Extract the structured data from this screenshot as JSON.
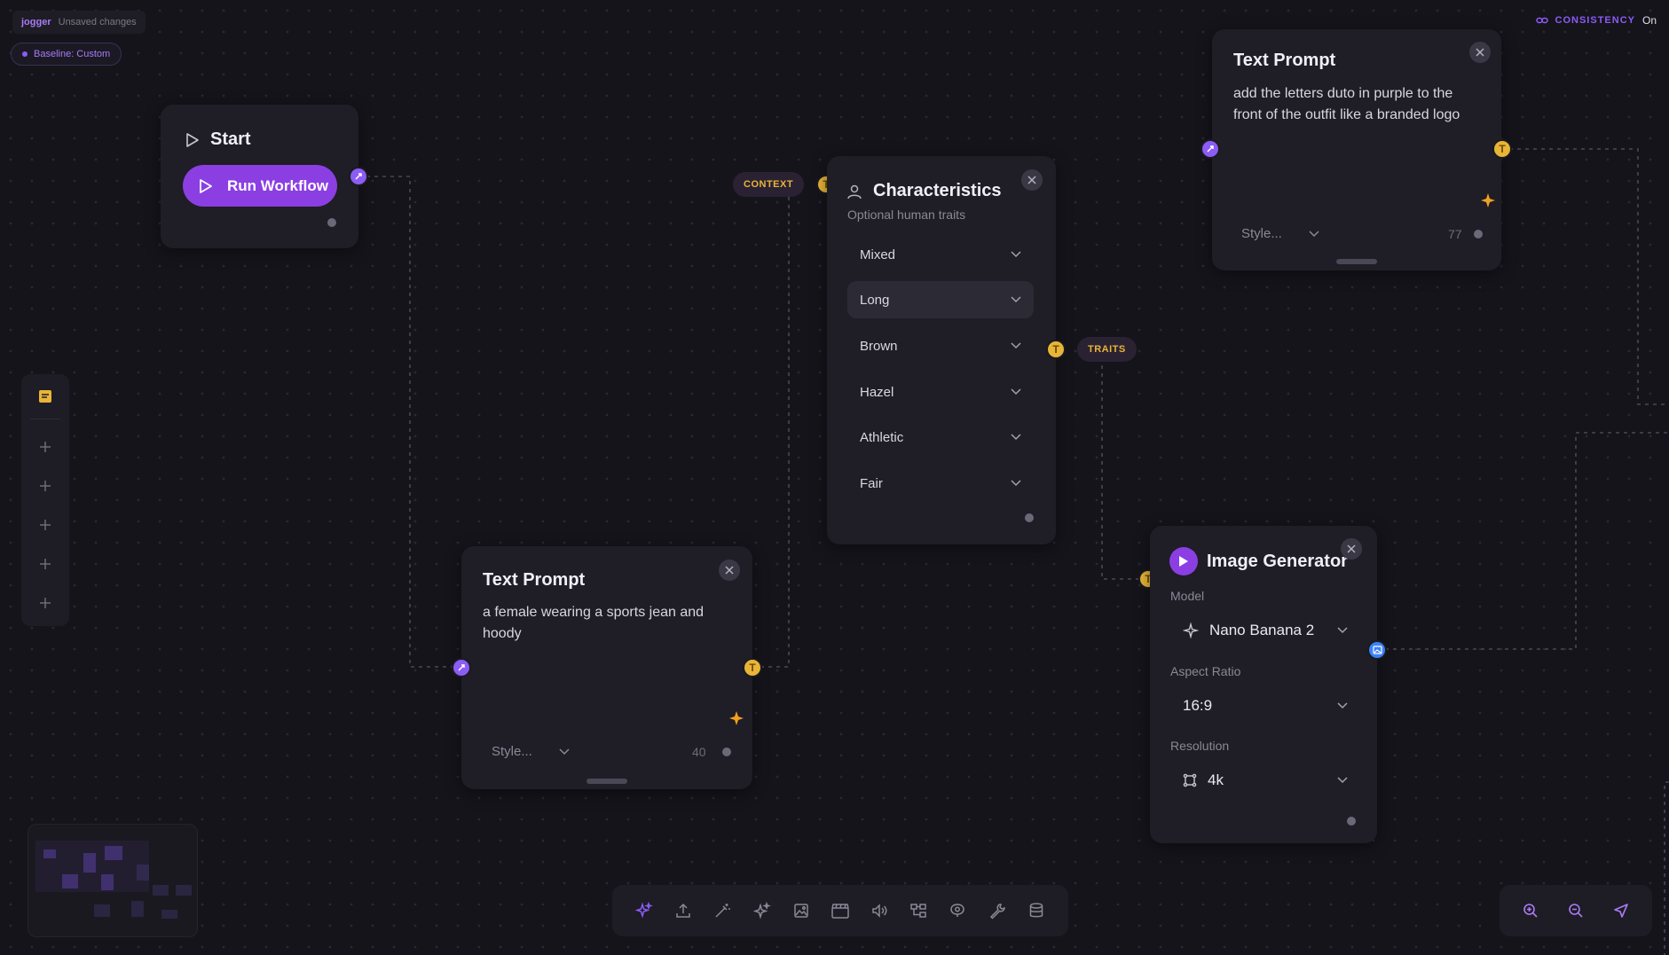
{
  "topbar": {
    "project_name": "jogger",
    "status": "Unsaved changes"
  },
  "baseline": {
    "label": "Baseline: Custom"
  },
  "consistency": {
    "label": "CONSISTENCY",
    "value": "On",
    "icon": "link-icon"
  },
  "start_node": {
    "title": "Start",
    "run_button": "Run Workflow"
  },
  "text_prompt_top": {
    "title": "Text Prompt",
    "text": "add the letters duto in purple to the front of the outfit like a branded logo",
    "style_placeholder": "Style...",
    "char_count": "77"
  },
  "text_prompt_bottom": {
    "title": "Text Prompt",
    "text": "a female wearing a sports jean and hoody",
    "style_placeholder": "Style...",
    "char_count": "40"
  },
  "characteristics": {
    "title": "Characteristics",
    "subtitle": "Optional human traits",
    "input_tag": "CONTEXT",
    "output_tag": "TRAITS",
    "dropdowns": [
      {
        "value": "Mixed"
      },
      {
        "value": "Long"
      },
      {
        "value": "Brown"
      },
      {
        "value": "Hazel"
      },
      {
        "value": "Athletic"
      },
      {
        "value": "Fair"
      }
    ]
  },
  "image_generator": {
    "title": "Image Generator",
    "model_label": "Model",
    "model_value": "Nano Banana 2",
    "aspect_label": "Aspect Ratio",
    "aspect_value": "16:9",
    "resolution_label": "Resolution",
    "resolution_value": "4k"
  },
  "port_glyph": "T",
  "colors": {
    "accent": "#8b3fe3",
    "accent_light": "#a97cf5",
    "text_port": "#e8b538",
    "image_port": "#3b82f6",
    "background": "#15141b",
    "card": "#1f1d26"
  }
}
